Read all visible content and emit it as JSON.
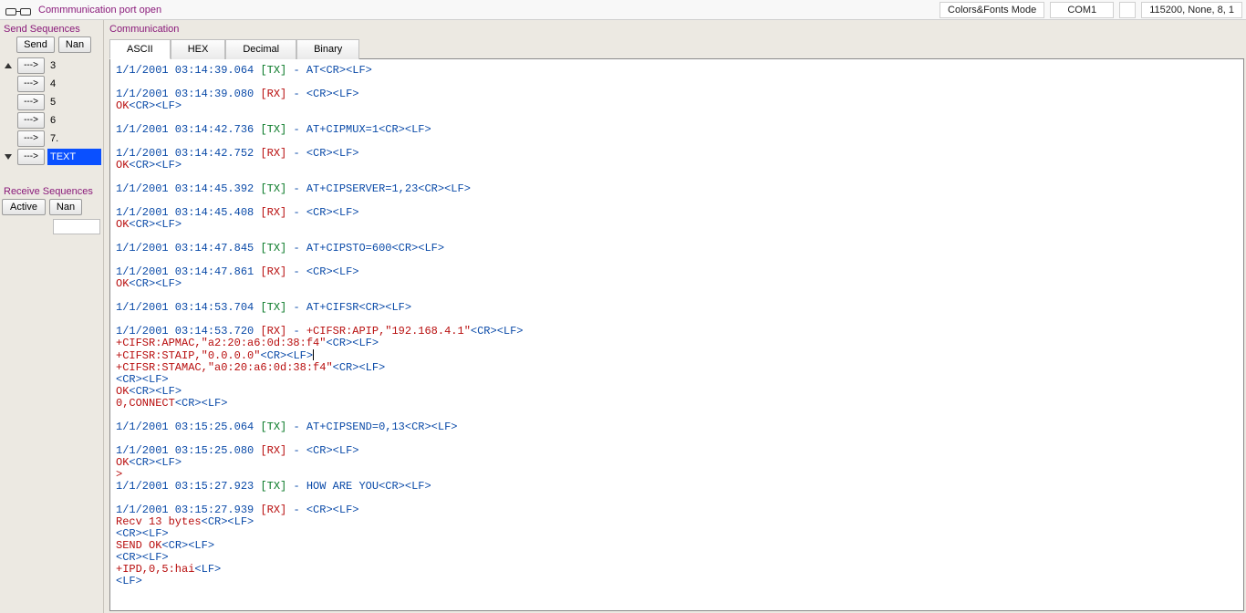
{
  "topbar": {
    "status": "Commmunication port open",
    "mode": "Colors&Fonts Mode",
    "port": "COM1",
    "serial": "115200, None, 8, 1"
  },
  "left": {
    "send_title": "Send Sequences",
    "send_btn": "Send",
    "name_btn": "Nan",
    "arrow_label": "--->",
    "rows": [
      {
        "label": "3",
        "selected": false,
        "arrow_up": true,
        "arrow_down": false
      },
      {
        "label": "4",
        "selected": false,
        "arrow_up": false,
        "arrow_down": false
      },
      {
        "label": "5",
        "selected": false,
        "arrow_up": false,
        "arrow_down": false
      },
      {
        "label": "6",
        "selected": false,
        "arrow_up": false,
        "arrow_down": false
      },
      {
        "label": "7.",
        "selected": false,
        "arrow_up": false,
        "arrow_down": false
      },
      {
        "label": "TEXT",
        "selected": true,
        "arrow_up": false,
        "arrow_down": true
      }
    ],
    "recv_title": "Receive Sequences",
    "active_btn": "Active",
    "recv_name_btn": "Nan"
  },
  "comm": {
    "title": "Communication",
    "tabs": {
      "ascii": "ASCII",
      "hex": "HEX",
      "decimal": "Decimal",
      "binary": "Binary"
    }
  },
  "log": [
    {
      "type": "tx",
      "ts": "1/1/2001 03:14:39.064",
      "text": "AT"
    },
    {
      "type": "blank"
    },
    {
      "type": "rx",
      "ts": "1/1/2001 03:14:39.080",
      "text": ""
    },
    {
      "type": "rxok"
    },
    {
      "type": "blank"
    },
    {
      "type": "tx",
      "ts": "1/1/2001 03:14:42.736",
      "text": "AT+CIPMUX=1"
    },
    {
      "type": "blank"
    },
    {
      "type": "rx",
      "ts": "1/1/2001 03:14:42.752",
      "text": ""
    },
    {
      "type": "rxok"
    },
    {
      "type": "blank"
    },
    {
      "type": "tx",
      "ts": "1/1/2001 03:14:45.392",
      "text": "AT+CIPSERVER=1,23"
    },
    {
      "type": "blank"
    },
    {
      "type": "rx",
      "ts": "1/1/2001 03:14:45.408",
      "text": ""
    },
    {
      "type": "rxok"
    },
    {
      "type": "blank"
    },
    {
      "type": "tx",
      "ts": "1/1/2001 03:14:47.845",
      "text": "AT+CIPSTO=600"
    },
    {
      "type": "blank"
    },
    {
      "type": "rx",
      "ts": "1/1/2001 03:14:47.861",
      "text": ""
    },
    {
      "type": "rxok"
    },
    {
      "type": "blank"
    },
    {
      "type": "tx",
      "ts": "1/1/2001 03:14:53.704",
      "text": "AT+CIFSR"
    },
    {
      "type": "blank"
    },
    {
      "type": "rx",
      "ts": "1/1/2001 03:14:53.720",
      "text": "+CIFSR:APIP,\"192.168.4.1\""
    },
    {
      "type": "rxbody",
      "text": "+CIFSR:APMAC,\"a2:20:a6:0d:38:f4\""
    },
    {
      "type": "rxbody-cursor",
      "text": "+CIFSR:STAIP,\"0.0.0.0\""
    },
    {
      "type": "rxbody",
      "text": "+CIFSR:STAMAC,\"a0:20:a6:0d:38:f4\""
    },
    {
      "type": "ctrlonly"
    },
    {
      "type": "rxok"
    },
    {
      "type": "rxbody",
      "text": "0,CONNECT"
    },
    {
      "type": "blank"
    },
    {
      "type": "tx",
      "ts": "1/1/2001 03:15:25.064",
      "text": "AT+CIPSEND=0,13"
    },
    {
      "type": "blank"
    },
    {
      "type": "rx",
      "ts": "1/1/2001 03:15:25.080",
      "text": ""
    },
    {
      "type": "rxok"
    },
    {
      "type": "rxbody-noctrl",
      "text": ">"
    },
    {
      "type": "tx",
      "ts": "1/1/2001 03:15:27.923",
      "text": "HOW ARE YOU"
    },
    {
      "type": "blank"
    },
    {
      "type": "rx",
      "ts": "1/1/2001 03:15:27.939",
      "text": ""
    },
    {
      "type": "rxbody",
      "text": "Recv 13 bytes"
    },
    {
      "type": "ctrlonly"
    },
    {
      "type": "rxbody",
      "text": "SEND OK"
    },
    {
      "type": "ctrlonly"
    },
    {
      "type": "rxbody-lf",
      "text": "+IPD,0,5:hai"
    },
    {
      "type": "lfonly"
    }
  ]
}
